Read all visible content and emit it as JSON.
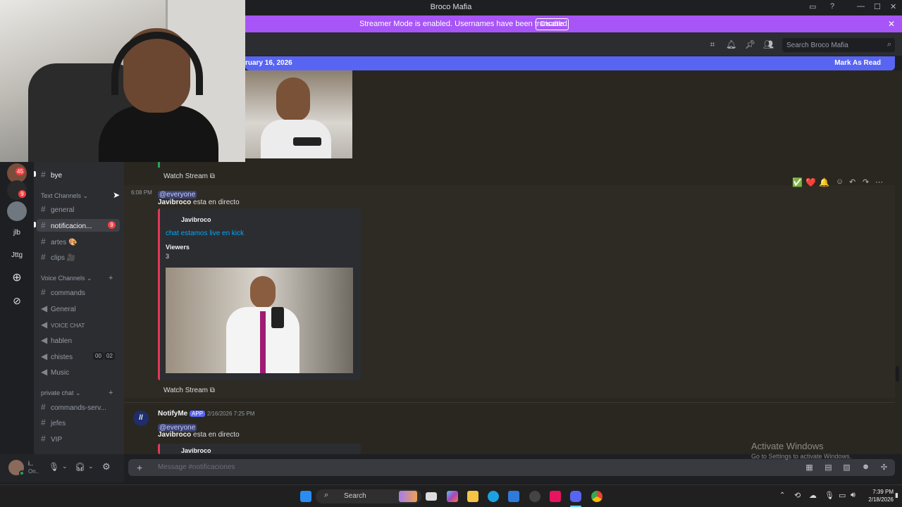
{
  "window": {
    "title": "Broco Mafia",
    "controls": [
      "—",
      "☐",
      "✕"
    ]
  },
  "streamer_banner": {
    "message": "Streamer Mode is enabled. Usernames have been truncated.",
    "button": "Disable"
  },
  "header": {
    "search_placeholder": "Search Broco Mafia"
  },
  "new_messages_bar": {
    "date_fragment": "ruary 16, 2026",
    "mark_label": "Mark As Read"
  },
  "guilds": [
    {
      "label": "",
      "badge": "45"
    },
    {
      "label": "",
      "badge": "9"
    },
    {
      "label": ""
    },
    {
      "label": "jlb"
    },
    {
      "label": "Jttg"
    }
  ],
  "sidebar": {
    "top_channel": "bye",
    "categories": [
      {
        "name": "Text Channels"
      },
      {
        "name": "Voice Channels"
      },
      {
        "name": "private chat"
      }
    ],
    "text_channels": [
      {
        "name": "general"
      },
      {
        "name": "notificacion...",
        "badge": "9"
      },
      {
        "name": "artes 🎨"
      },
      {
        "name": "clips 🎥"
      }
    ],
    "voice_channels": [
      {
        "name": "commands",
        "kind": "text"
      },
      {
        "name": "General",
        "kind": "voice"
      },
      {
        "name": "VOICE CHAT",
        "kind": "voice"
      },
      {
        "name": "hablen",
        "kind": "voice"
      },
      {
        "name": "chistes",
        "kind": "voice",
        "counter_a": "00",
        "counter_b": "02"
      },
      {
        "name": "Music",
        "kind": "voice"
      }
    ],
    "private_channels": [
      {
        "name": "commands-serv..."
      },
      {
        "name": "jefes"
      },
      {
        "name": "VIP"
      }
    ]
  },
  "messages": {
    "watch_stream_1": "Watch Stream",
    "time_1": "6:08 PM",
    "mention": "@everyone",
    "line_author": "Javibroco",
    "line_text": "esta en directo",
    "embed": {
      "author": "Javibroco",
      "title": "chat estamos live en kick",
      "field_label": "Viewers",
      "field_value": "3"
    },
    "watch_stream_2": "Watch Stream",
    "next_author": "NotifyMe",
    "app_tag": "APP",
    "next_timestamp": "2/16/2026 7:25 PM",
    "next_mention": "@everyone",
    "next_line_author": "Javibroco",
    "next_line_text": "esta en directo",
    "next_embed_author": "Javibroco"
  },
  "reactions": [
    "✅",
    "❤️",
    "🔔"
  ],
  "composer": {
    "placeholder": "Message #notificaciones"
  },
  "watermark": {
    "title": "Activate Windows",
    "subtitle": "Go to Settings to activate Windows."
  },
  "taskbar": {
    "search_label": "Search",
    "time": "7:39 PM",
    "date": "2/18/2026"
  },
  "colors": {
    "streamer_banner": "#a855f7",
    "blurple": "#5865f2",
    "embed_bar": "#e4375a",
    "badge_red": "#f23f43"
  }
}
